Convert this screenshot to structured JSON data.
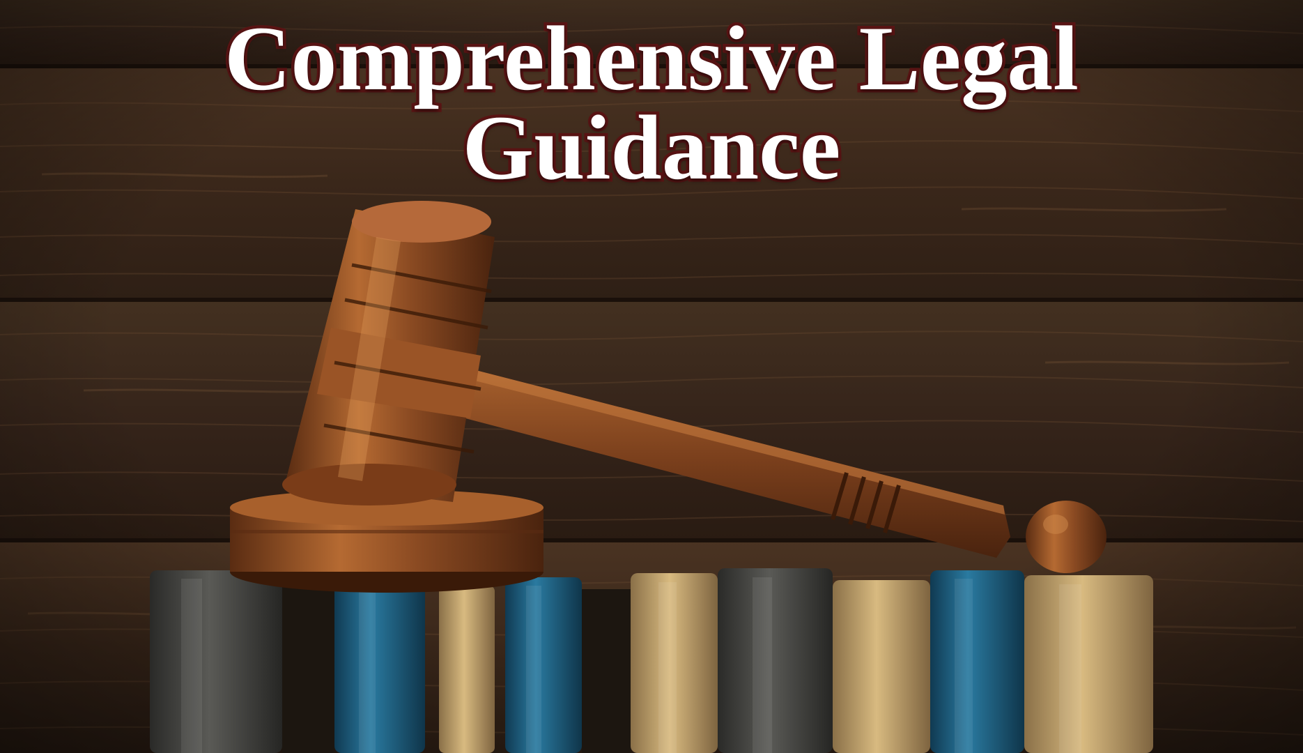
{
  "headline": {
    "line1": "Comprehensive Legal",
    "line2": "Guidance"
  },
  "colors": {
    "title_text": "#ffffff",
    "title_outline": "#5a1414",
    "wood_wall": "#3b281b",
    "gavel_wood": "#8a4a22",
    "book_blue": "#1f5f80",
    "book_tan": "#c9a870",
    "book_gray": "#4a4a48"
  }
}
